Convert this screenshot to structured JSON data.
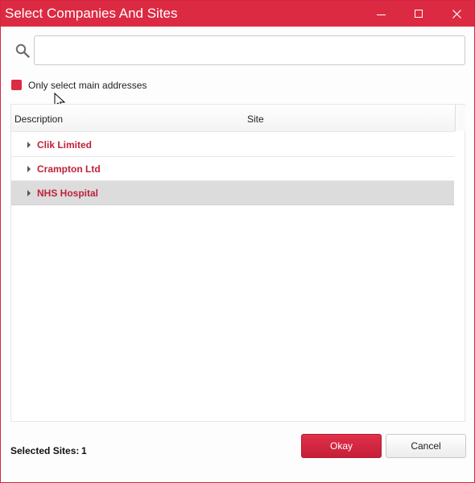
{
  "window": {
    "title": "Select Companies And Sites",
    "controls": [
      "minimize-icon",
      "maximize-icon",
      "close-icon"
    ],
    "accent_color": "#dc2a43"
  },
  "search": {
    "icon": "search-icon",
    "value": "",
    "placeholder": ""
  },
  "filter": {
    "label": "Only select main addresses",
    "checked": true
  },
  "grid": {
    "columns": [
      "Description",
      "Site"
    ],
    "rows": [
      {
        "description": "Clik Limited",
        "site": "",
        "selected": false
      },
      {
        "description": "Crampton Ltd",
        "site": "",
        "selected": false
      },
      {
        "description": "NHS Hospital",
        "site": "",
        "selected": true
      }
    ]
  },
  "footer": {
    "selected_label": "Selected Sites:",
    "selected_count": "1",
    "okay_label": "Okay",
    "cancel_label": "Cancel"
  }
}
